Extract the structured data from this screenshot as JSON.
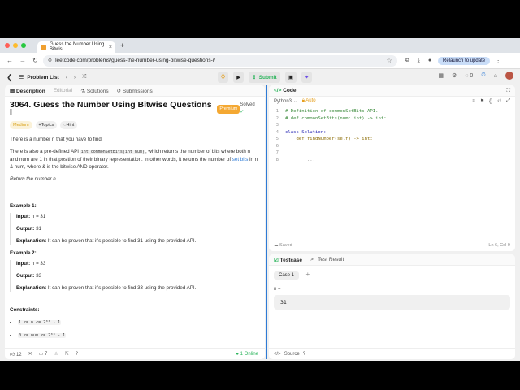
{
  "browser": {
    "tab_title": "Guess the Number Using Bitwis",
    "new_tab": "+",
    "url": "leetcode.com/problems/guess-the-number-using-bitwise-questions-i/",
    "relaunch": "Relaunch to update"
  },
  "topbar": {
    "problem_list": "Problem List",
    "submit": "Submit",
    "streak": "0"
  },
  "description_tabs": [
    "Description",
    "Editorial",
    "Solutions",
    "Submissions"
  ],
  "problem": {
    "title": "3064. Guess the Number Using Bitwise Questions I",
    "premium": "Premium",
    "solved": "Solved",
    "difficulty": "Medium",
    "topics": "Topics",
    "hint": "Hint",
    "p1": "There is a number n that you have to find.",
    "p2a": "There is also a pre-defined API",
    "p2_code": "int commonSetBits(int num)",
    "p2b": ", which returns the number of bits where both",
    "p2c": "n and num are 1 in that position of their binary representation. In other words, it returns the number of",
    "set_bits": "set bits",
    "p2d": "in n & num, where & is the bitwise AND operator.",
    "p3": "Return the number n.",
    "examples": [
      {
        "title": "Example 1:",
        "input": "n = 31",
        "output": "31",
        "explanation": "It can be proven that it's possible to find 31 using the provided API."
      },
      {
        "title": "Example 2:",
        "input": "n = 33",
        "output": "33",
        "explanation": "It can be proven that it's possible to find 33 using the provided API."
      }
    ],
    "input_label": "Input:",
    "output_label": "Output:",
    "explanation_label": "Explanation:",
    "constraints_title": "Constraints:",
    "constraints": [
      "1 <= n <= 2³⁰ - 1",
      "0 <= num <= 2³⁰ - 1"
    ]
  },
  "left_bottom": {
    "likes": "12",
    "comments": "7",
    "online_count": "1",
    "online_label": "Online"
  },
  "code": {
    "header": "Code",
    "language": "Python3",
    "auto": "Auto",
    "lines": [
      "# Definition of commonSetBits API.",
      "# def commonSetBits(num: int) -> int:",
      "",
      "class Solution:",
      "    def findNumber(self) -> int:",
      "",
      "",
      "        ..."
    ],
    "saved": "Saved",
    "cursor": "Ln 6, Col 9"
  },
  "testcase": {
    "tab1": "Testcase",
    "tab2": "Test Result",
    "case": "Case 1",
    "var": "n =",
    "value": "31",
    "source": "Source"
  },
  "colors": {
    "accent": "#2e7bd6",
    "submit": "#2db55d",
    "premium": "#f4a832"
  }
}
